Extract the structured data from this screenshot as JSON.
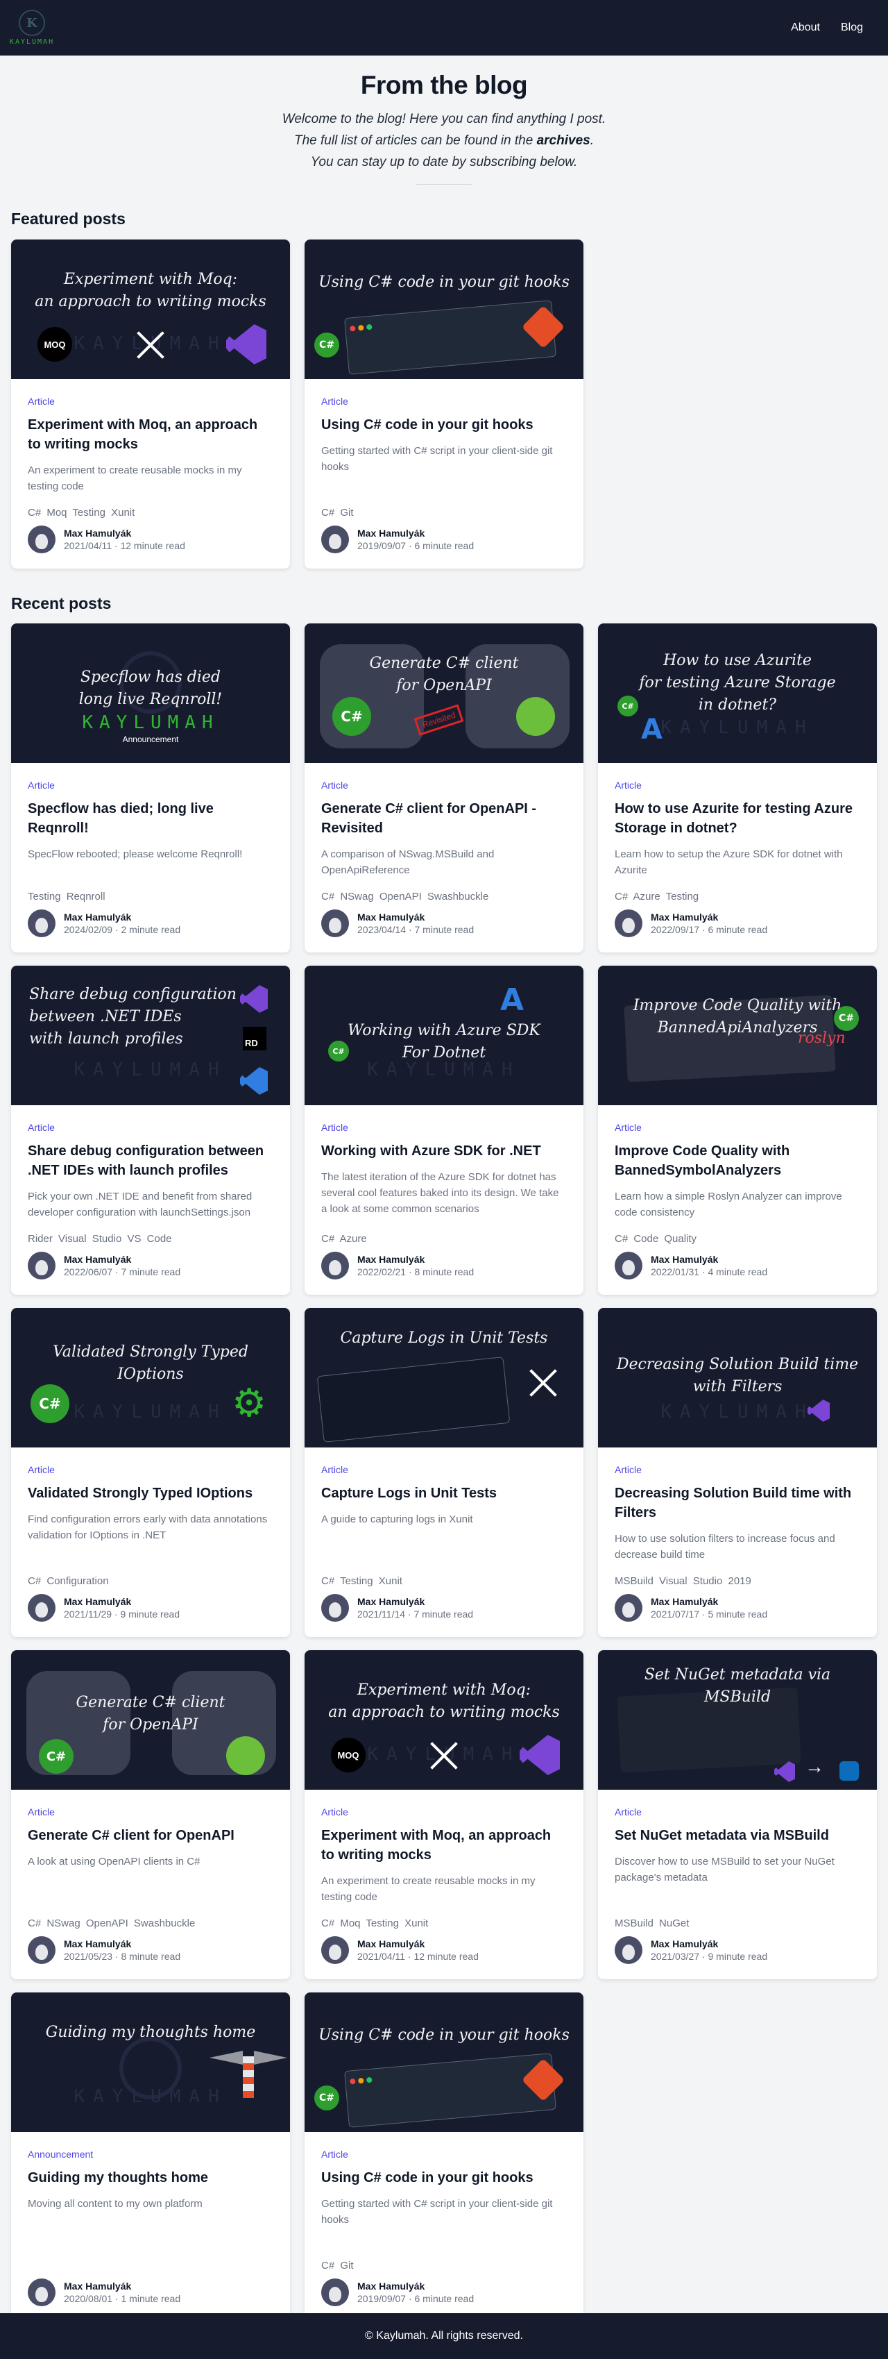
{
  "nav": {
    "logo_text": "KAYLUMAH",
    "about": "About",
    "blog": "Blog"
  },
  "header": {
    "title": "From the blog",
    "intro_line1": "Welcome to the blog! Here you can find anything I post.",
    "intro_line2_pre": "The full list of articles can be found in the",
    "intro_line2_link": "archives",
    "intro_line2_post": ".",
    "intro_line3": "You can stay up to date by subscribing below."
  },
  "featured": {
    "title": "Featured posts",
    "posts": [
      {
        "category": "Article",
        "title": "Experiment with Moq, an approach to writing mocks",
        "excerpt": "An experiment to create reusable mocks in my testing code",
        "tags": "C# Moq Testing Xunit",
        "author": "Max Hamulyák",
        "meta": "2021/04/11 · 12 minute read",
        "thumb_caption": "Experiment with Moq:\nan approach to writing mocks"
      },
      {
        "category": "Article",
        "title": "Using C# code in your git hooks",
        "excerpt": "Getting started with C# script in your client-side git hooks",
        "tags": "C# Git",
        "author": "Max Hamulyák",
        "meta": "2019/09/07 · 6 minute read",
        "thumb_caption": "Using C# code in your git hooks"
      }
    ]
  },
  "recent": {
    "title": "Recent posts",
    "posts": [
      {
        "category": "Article",
        "title": "Specflow has died; long live Reqnroll!",
        "excerpt": "SpecFlow rebooted; please welcome Reqnroll!",
        "tags": "Testing Reqnroll",
        "author": "Max Hamulyák",
        "meta": "2024/02/09 · 2 minute read",
        "thumb_caption": "Specflow has died\nlong live Reqnroll!",
        "thumb_brand": "KAYLUMAH",
        "thumb_tag": "Announcement"
      },
      {
        "category": "Article",
        "title": "Generate C# client for OpenAPI - Revisited",
        "excerpt": "A comparison of NSwag.MSBuild and OpenApiReference",
        "tags": "C# NSwag OpenAPI Swashbuckle",
        "author": "Max Hamulyák",
        "meta": "2023/04/14 · 7 minute read",
        "thumb_caption": "Generate C# client\nfor OpenAPI",
        "thumb_stamp": "Revisited"
      },
      {
        "category": "Article",
        "title": "How to use Azurite for testing Azure Storage in dotnet?",
        "excerpt": "Learn how to setup the Azure SDK for dotnet with Azurite",
        "tags": "C# Azure Testing",
        "author": "Max Hamulyák",
        "meta": "2022/09/17 · 6 minute read",
        "thumb_caption": "How to use Azurite\nfor testing Azure Storage\nin dotnet?"
      },
      {
        "category": "Article",
        "title": "Share debug configuration between .NET IDEs with launch profiles",
        "excerpt": "Pick your own .NET IDE and benefit from shared developer configuration with launchSettings.json",
        "tags": "Rider Visual Studio VS Code",
        "author": "Max Hamulyák",
        "meta": "2022/06/07 · 7 minute read",
        "thumb_caption": "Share debug configuration\nbetween .NET IDEs\nwith launch profiles"
      },
      {
        "category": "Article",
        "title": "Working with Azure SDK for .NET",
        "excerpt": "The latest iteration of the Azure SDK for dotnet has several cool features baked into its design. We take a look at some common scenarios",
        "tags": "C# Azure",
        "author": "Max Hamulyák",
        "meta": "2022/02/21 · 8 minute read",
        "thumb_caption": "Working with Azure SDK\nFor Dotnet"
      },
      {
        "category": "Article",
        "title": "Improve Code Quality with BannedSymbolAnalyzers",
        "excerpt": "Learn how a simple Roslyn Analyzer can improve code consistency",
        "tags": "C# Code Quality",
        "author": "Max Hamulyák",
        "meta": "2022/01/31 · 4 minute read",
        "thumb_caption": "Improve Code Quality with\nBannedApiAnalyzers",
        "thumb_brand": "roslyn"
      },
      {
        "category": "Article",
        "title": "Validated Strongly Typed IOptions",
        "excerpt": "Find configuration errors early with data annotations validation for IOptions in .NET",
        "tags": "C# Configuration",
        "author": "Max Hamulyák",
        "meta": "2021/11/29 · 9 minute read",
        "thumb_caption": "Validated Strongly Typed IOptions"
      },
      {
        "category": "Article",
        "title": "Capture Logs in Unit Tests",
        "excerpt": "A guide to capturing logs in Xunit",
        "tags": "C# Testing Xunit",
        "author": "Max Hamulyák",
        "meta": "2021/11/14 · 7 minute read",
        "thumb_caption": "Capture Logs in Unit Tests"
      },
      {
        "category": "Article",
        "title": "Decreasing Solution Build time with Filters",
        "excerpt": "How to use solution filters to increase focus and decrease build time",
        "tags": "MSBuild Visual Studio 2019",
        "author": "Max Hamulyák",
        "meta": "2021/07/17 · 5 minute read",
        "thumb_caption": "Decreasing Solution Build time\nwith Filters"
      },
      {
        "category": "Article",
        "title": "Generate C# client for OpenAPI",
        "excerpt": "A look at using OpenAPI clients in C#",
        "tags": "C# NSwag OpenAPI Swashbuckle",
        "author": "Max Hamulyák",
        "meta": "2021/05/23 · 8 minute read",
        "thumb_caption": "Generate C# client\nfor OpenAPI"
      },
      {
        "category": "Article",
        "title": "Experiment with Moq, an approach to writing mocks",
        "excerpt": "An experiment to create reusable mocks in my testing code",
        "tags": "C# Moq Testing Xunit",
        "author": "Max Hamulyák",
        "meta": "2021/04/11 · 12 minute read",
        "thumb_caption": "Experiment with Moq:\nan approach to writing mocks"
      },
      {
        "category": "Article",
        "title": "Set NuGet metadata via MSBuild",
        "excerpt": "Discover how to use MSBuild to set your NuGet package's metadata",
        "tags": "MSBuild NuGet",
        "author": "Max Hamulyák",
        "meta": "2021/03/27 · 9 minute read",
        "thumb_caption": "Set NuGet metadata via MSBuild"
      },
      {
        "category": "Announcement",
        "title": "Guiding my thoughts home",
        "excerpt": "Moving all content to my own platform",
        "tags": "",
        "author": "Max Hamulyák",
        "meta": "2020/08/01 · 1 minute read",
        "thumb_caption": "Guiding my thoughts home"
      },
      {
        "category": "Article",
        "title": "Using C# code in your git hooks",
        "excerpt": "Getting started with C# script in your client-side git hooks",
        "tags": "C# Git",
        "author": "Max Hamulyák",
        "meta": "2019/09/07 · 6 minute read",
        "thumb_caption": "Using C# code in your git hooks"
      }
    ]
  },
  "footer": {
    "text": "© Kaylumah. All rights reserved."
  },
  "colors": {
    "navbar": "#171b2e",
    "accent": "#4f46e5",
    "csharp_green": "#2e9e2e",
    "git_orange": "#e44d26",
    "vs_purple": "#7b45d6"
  }
}
